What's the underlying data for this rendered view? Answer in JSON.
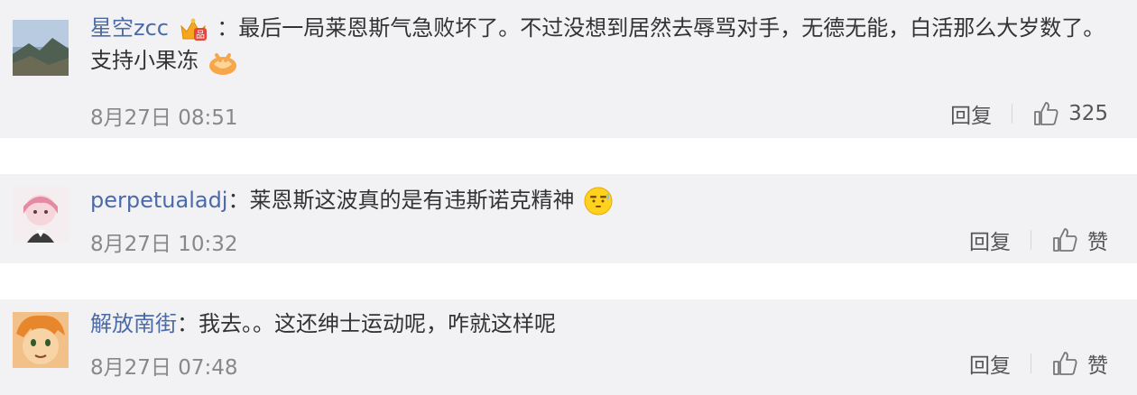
{
  "comments": [
    {
      "username": "星空zcc",
      "badge": "crown-vip-badge",
      "colon": "：",
      "text": "最后一局莱恩斯气急败坏了。不过没想到居然去辱骂对手，无德无能，白活那么大岁数了。支持小果冻",
      "emoji": "handshake-emoji",
      "timestamp": "8月27日 08:51",
      "reply_label": "回复",
      "like_label": "325"
    },
    {
      "username": "perpetualadj",
      "colon": "：",
      "text": "莱恩斯这波真的是有违斯诺克精神",
      "emoji": "awkward-face-emoji",
      "timestamp": "8月27日 10:32",
      "reply_label": "回复",
      "like_label": "赞"
    },
    {
      "username": "解放南街",
      "colon": "：",
      "text": "我去。。这还绅士运动呢，咋就这样呢",
      "timestamp": "8月27日 07:48",
      "reply_label": "回复",
      "like_label": "赞"
    }
  ],
  "colors": {
    "background": "#f2f2f5",
    "username": "#4b6aa7",
    "text": "#333333",
    "meta": "#888888"
  }
}
